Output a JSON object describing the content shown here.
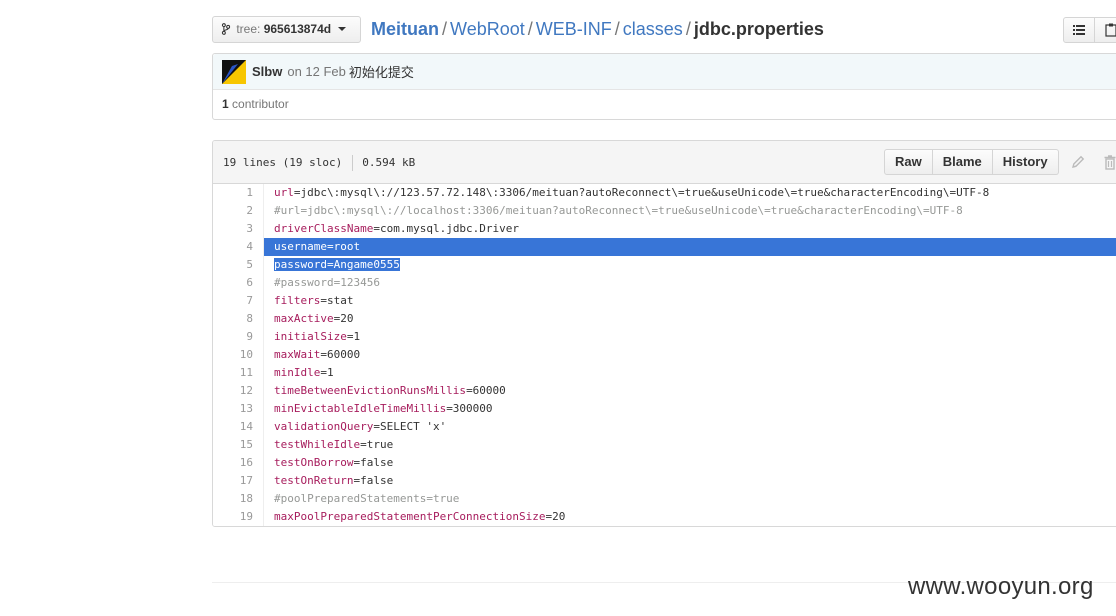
{
  "branch": {
    "label": "tree:",
    "value": "965613874d"
  },
  "breadcrumb": {
    "repo": "Meituan",
    "sep": "/",
    "parts": [
      "WebRoot",
      "WEB-INF",
      "classes"
    ],
    "file": "jdbc.properties"
  },
  "commit": {
    "author": "Slbw",
    "date": "on 12 Feb",
    "message": "初始化提交",
    "contributors_count": "1",
    "contributors_label": "contributor"
  },
  "file": {
    "lines_info": "19 lines (19 sloc)",
    "size": "0.594 kB",
    "buttons": {
      "raw": "Raw",
      "blame": "Blame",
      "history": "History"
    }
  },
  "code": [
    {
      "n": "1",
      "key": "url",
      "val": "=jdbc\\:mysql\\://123.57.72.148\\:3306/meituan?autoReconnect\\=true&useUnicode\\=true&characterEncoding\\=UTF-8"
    },
    {
      "n": "2",
      "comment": "#url=jdbc\\:mysql\\://localhost:3306/meituan?autoReconnect\\=true&useUnicode\\=true&characterEncoding\\=UTF-8"
    },
    {
      "n": "3",
      "key": "driverClassName",
      "val": "=com.mysql.jdbc.Driver"
    },
    {
      "n": "4",
      "key": "username",
      "val": "=root"
    },
    {
      "n": "5",
      "key": "password",
      "val": "=Angame0555"
    },
    {
      "n": "6",
      "comment": "#password=123456"
    },
    {
      "n": "7",
      "key": "filters",
      "val": "=stat"
    },
    {
      "n": "8",
      "key": "maxActive",
      "val": "=20"
    },
    {
      "n": "9",
      "key": "initialSize",
      "val": "=1"
    },
    {
      "n": "10",
      "key": "maxWait",
      "val": "=60000"
    },
    {
      "n": "11",
      "key": "minIdle",
      "val": "=1"
    },
    {
      "n": "12",
      "key": "timeBetweenEvictionRunsMillis",
      "val": "=60000"
    },
    {
      "n": "13",
      "key": "minEvictableIdleTimeMillis",
      "val": "=300000"
    },
    {
      "n": "14",
      "key": "validationQuery",
      "val": "=SELECT 'x'"
    },
    {
      "n": "15",
      "key": "testWhileIdle",
      "val": "=true"
    },
    {
      "n": "16",
      "key": "testOnBorrow",
      "val": "=false"
    },
    {
      "n": "17",
      "key": "testOnReturn",
      "val": "=false"
    },
    {
      "n": "18",
      "comment": "#poolPreparedStatements=true"
    },
    {
      "n": "19",
      "key": "maxPoolPreparedStatementPerConnectionSize",
      "val": "=20"
    }
  ],
  "selection_color": "#3875d7",
  "watermark": "www.wooyun.org"
}
